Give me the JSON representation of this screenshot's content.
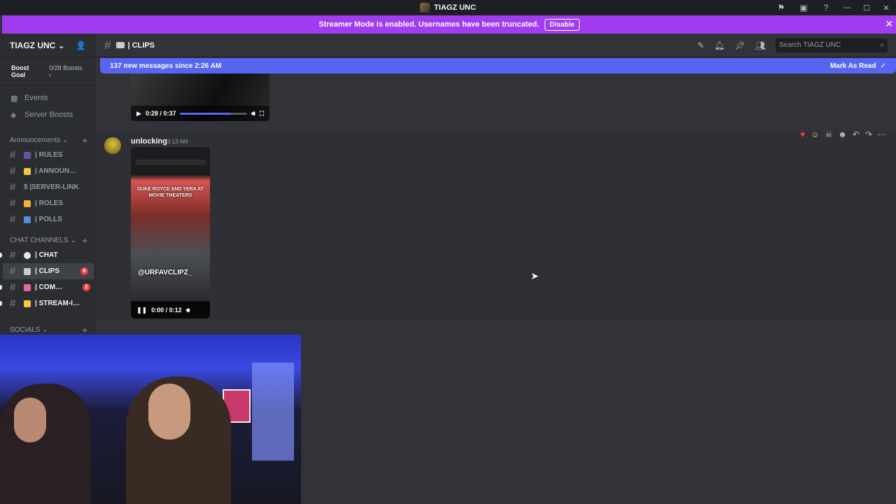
{
  "window": {
    "title": "TIAGZ UNC",
    "icons": [
      "flag-icon",
      "screen-share-icon",
      "help-icon"
    ],
    "controls": [
      "minimize",
      "maximize",
      "close"
    ]
  },
  "banner": {
    "text": "Streamer Mode is enabled. Usernames have been truncated.",
    "button_label": "Disable"
  },
  "guild": {
    "name": "TIAGZ UNC",
    "boost_goal_label": "Boost Goal",
    "boost_count": "0/28 Boosts"
  },
  "sidebar": {
    "nav": [
      {
        "label": "Events",
        "icon": "calendar-icon"
      },
      {
        "label": "Server Boosts",
        "icon": "boost-icon"
      }
    ],
    "categories": [
      {
        "label": "Announcements",
        "channels": [
          {
            "label": "| RULES",
            "emoji_color": "#6b4fa8"
          },
          {
            "label": "| ANNOUN…",
            "emoji_color": "#f5c542"
          },
          {
            "label": "$ |SERVER-LINK",
            "emoji_color": ""
          },
          {
            "label": "| ROLES",
            "emoji_color": "#f0b232"
          },
          {
            "label": "| POLLS",
            "emoji_color": "#4f8fd8"
          }
        ]
      },
      {
        "label": "CHAT CHANNELS",
        "channels": [
          {
            "label": "| CHAT",
            "emoji_color": "#e8e8e8",
            "unread": true
          },
          {
            "label": "| CLIPS",
            "emoji_color": "#c7ccd1",
            "selected": true,
            "badge": "6"
          },
          {
            "label": "| COM…",
            "emoji_color": "#e56a9b",
            "unread": true,
            "badge": "2"
          },
          {
            "label": "| STREAM-I…",
            "emoji_color": "#f5c542",
            "unread": true
          }
        ]
      },
      {
        "label": "SOCIALS",
        "channels": []
      }
    ]
  },
  "channel_header": {
    "name": "| CLIPS",
    "search_placeholder": "Search TIAGZ UNC",
    "tools": [
      "threads-icon",
      "bell-icon",
      "pin-icon",
      "members-icon"
    ]
  },
  "new_messages": {
    "text": "137 new messages since 2:26 AM",
    "mark_label": "Mark As Read"
  },
  "messages": {
    "prev_video": {
      "time": "0:28 / 0:37",
      "progress": 0.757
    },
    "current": {
      "author": "unlocking",
      "time": "3:13 AM",
      "video": {
        "caption": "DUKE ROYCE AND YERA AT MOVIE THEATERS",
        "handle": "@URFAVCLIPZ_",
        "time": "0:00 / 0:12",
        "progress": 0.0
      },
      "reactions": [
        "heart-icon",
        "laugh-icon",
        "skull-icon"
      ],
      "actions": [
        "add-reaction-icon",
        "reply-icon",
        "forward-icon",
        "more-icon"
      ]
    }
  }
}
